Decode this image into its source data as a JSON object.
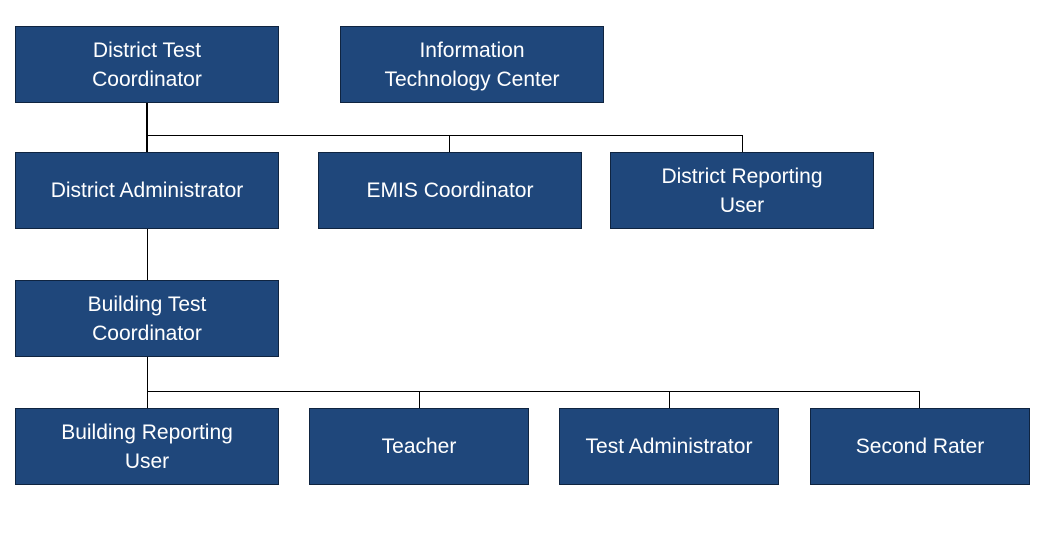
{
  "box_color": "#1f477b",
  "nodes": [
    {
      "id": "district-test-coordinator",
      "label": "District Test\nCoordinator"
    },
    {
      "id": "information-technology-center",
      "label": "Information\nTechnology Center"
    },
    {
      "id": "district-administrator",
      "label": "District Administrator"
    },
    {
      "id": "emis-coordinator",
      "label": "EMIS Coordinator"
    },
    {
      "id": "district-reporting-user",
      "label": "District Reporting\nUser"
    },
    {
      "id": "building-test-coordinator",
      "label": "Building Test\nCoordinator"
    },
    {
      "id": "building-reporting-user",
      "label": "Building Reporting\nUser"
    },
    {
      "id": "teacher",
      "label": "Teacher"
    },
    {
      "id": "test-administrator",
      "label": "Test Administrator"
    },
    {
      "id": "second-rater",
      "label": "Second Rater"
    }
  ],
  "edges": [
    [
      "district-test-coordinator",
      "district-administrator"
    ],
    [
      "district-test-coordinator",
      "emis-coordinator"
    ],
    [
      "district-test-coordinator",
      "district-reporting-user"
    ],
    [
      "district-administrator",
      "building-test-coordinator"
    ],
    [
      "building-test-coordinator",
      "building-reporting-user"
    ],
    [
      "building-test-coordinator",
      "teacher"
    ],
    [
      "building-test-coordinator",
      "test-administrator"
    ],
    [
      "building-test-coordinator",
      "second-rater"
    ]
  ]
}
